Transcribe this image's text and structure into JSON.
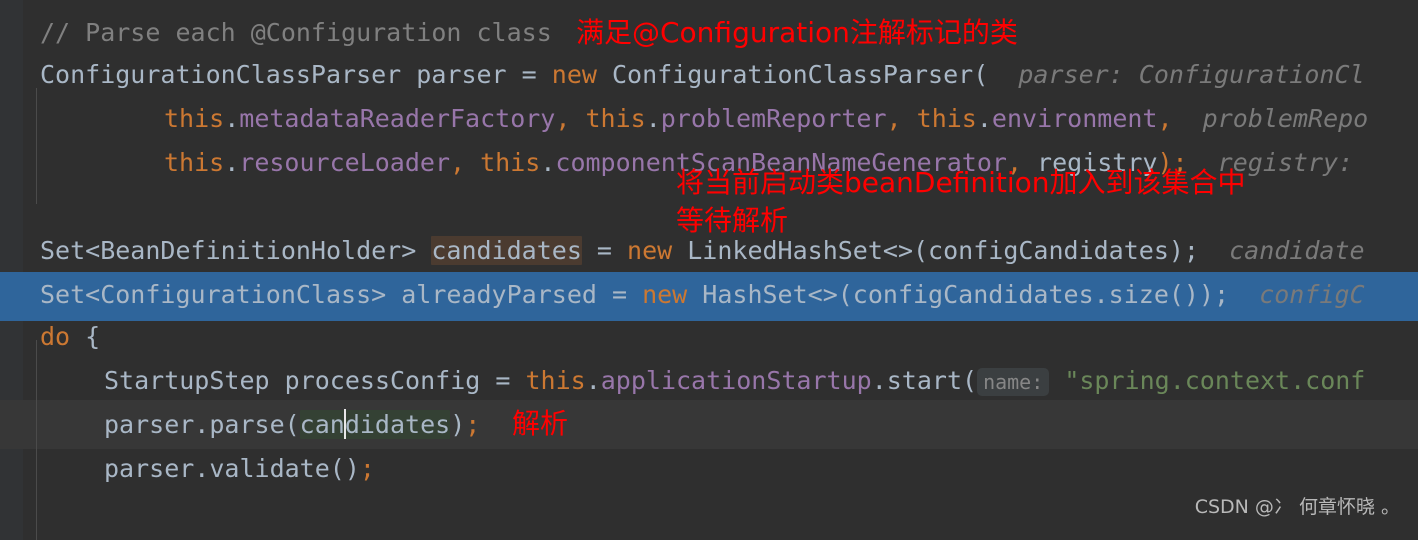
{
  "editor": {
    "background_color": "#2f2f2f",
    "gutter_color": "#313335",
    "selection_color": "#2f659b",
    "caret_line_color": "#373737",
    "annotation_color": "#ff0000",
    "write_highlight_color": "#4b3b30",
    "identifier_highlight_color": "#344134"
  },
  "code": {
    "line1": {
      "comment": "// Parse each @Configuration class"
    },
    "line2": {
      "type": "ConfigurationClassParser",
      "space1": " ",
      "var": "parser",
      "eq": " = ",
      "kw_new": "new",
      "ctor": " ConfigurationClassParser(",
      "hint": "  parser: ConfigurationCl"
    },
    "line3": {
      "this1": "this",
      "dot1": ".",
      "field1": "metadataReaderFactory",
      "comma1": ", ",
      "this2": "this",
      "dot2": ".",
      "field2": "problemReporter",
      "comma2": ", ",
      "this3": "this",
      "dot3": ".",
      "field3": "environment",
      "comma3": ",",
      "hint": "  problemRepo"
    },
    "line4": {
      "this1": "this",
      "dot1": ".",
      "field1": "resourceLoader",
      "comma1": ", ",
      "this2": "this",
      "dot2": ".",
      "field2": "componentScanBeanNameGenerator",
      "comma2": ", ",
      "arg": "registry",
      "tail": ");",
      "hint": "  registry:"
    },
    "line6": {
      "type": "Set<BeanDefinitionHolder>",
      "space": " ",
      "var": "candidates",
      "eq": " = ",
      "kw_new": "new",
      "ctor": " LinkedHashSet<>(configCandidates);",
      "hint": "  candidate"
    },
    "line7": {
      "type": "Set<ConfigurationClass>",
      "space": " ",
      "var": "alreadyParsed",
      "eq": " = ",
      "kw_new": "new",
      "ctor": " HashSet<>(configCandidates.size());",
      "hint": "  configC"
    },
    "line8": {
      "kw_do": "do",
      "brace": " {"
    },
    "line9": {
      "type": "StartupStep",
      "space": " ",
      "var": "processConfig",
      "eq": " = ",
      "this": "this",
      "dot1": ".",
      "field": "applicationStartup",
      "dot2": ".",
      "method": "start(",
      "inlay": "name:",
      "string": " \"spring.context.conf"
    },
    "line10": {
      "call_prefix": "parser.parse(",
      "arg_a": "can",
      "arg_b": "didates",
      "call_suffix": ")",
      "semi": ";"
    },
    "line11": {
      "call": "parser.validate()",
      "semi": ";"
    }
  },
  "annotations": {
    "a1": "满足@Configuration注解标记的类",
    "a2_line1": "将当前启动类beanDefinition加入到该集合中",
    "a2_line2": "等待解析",
    "a3": "解析"
  },
  "watermark": {
    "text": "CSDN @冫 何章怀晓 。"
  }
}
